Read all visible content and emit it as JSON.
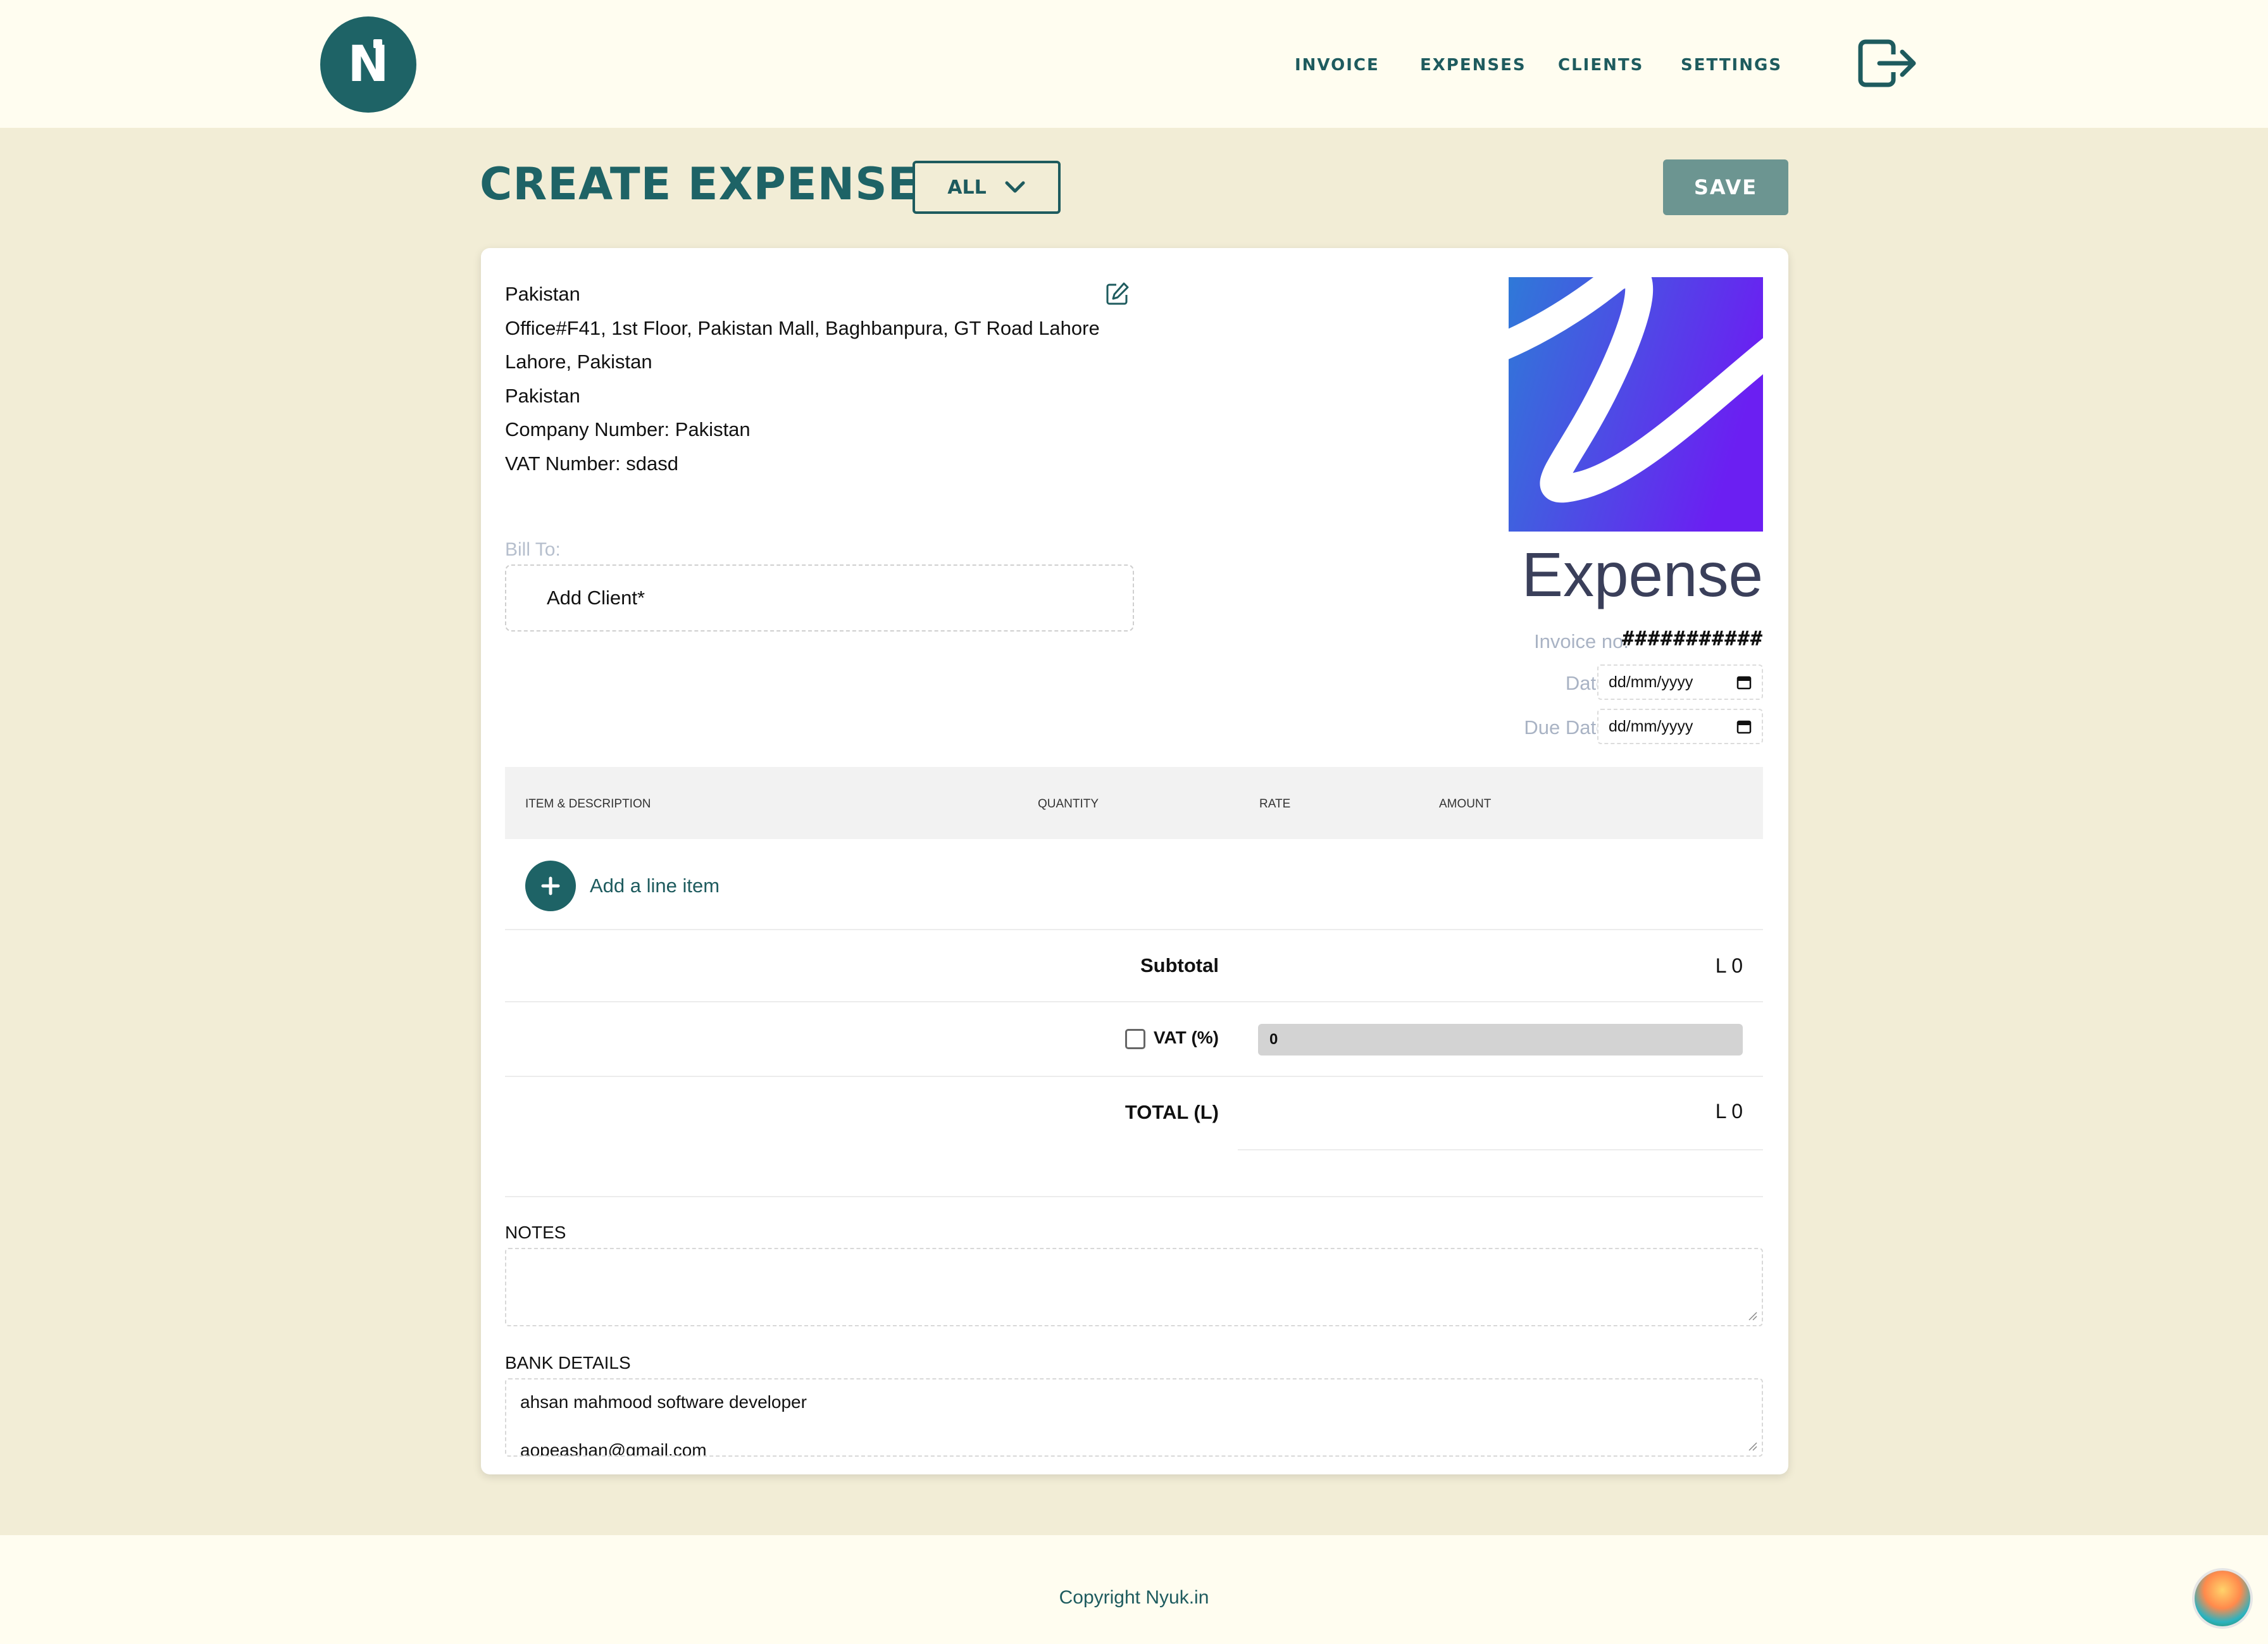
{
  "header": {
    "logo_text": "N",
    "nav": [
      "INVOICE",
      "EXPENSES",
      "CLIENTS",
      "SETTINGS"
    ]
  },
  "page": {
    "title": "CREATE EXPENSE",
    "filter_value": "ALL",
    "save_label": "SAVE"
  },
  "company": {
    "lines": [
      "Pakistan",
      "Office#F41, 1st Floor, Pakistan Mall, Baghbanpura, GT Road Lahore",
      "Lahore, Pakistan",
      "Pakistan",
      "Company Number: Pakistan",
      "VAT Number: sdasd"
    ]
  },
  "document": {
    "type": "Expense",
    "invoice_no_label": "Invoice no:",
    "invoice_no_value": "###########",
    "date_label": "Date:",
    "date_placeholder": "dd/mm/yyyy",
    "due_date_label": "Due Date:",
    "due_date_placeholder": "dd/mm/yyyy"
  },
  "bill_to": {
    "label": "Bill To:",
    "add_client": "Add Client*"
  },
  "items_table": {
    "columns": [
      "ITEM & DESCRIPTION",
      "QUANTITY",
      "RATE",
      "AMOUNT"
    ],
    "add_line_label": "Add a line item"
  },
  "totals": {
    "subtotal_label": "Subtotal",
    "subtotal_value": "L 0",
    "vat_label": "VAT (%)",
    "vat_value": "0",
    "total_label": "TOTAL (L)",
    "total_value": "L 0"
  },
  "notes": {
    "label": "NOTES",
    "value": ""
  },
  "bank_details": {
    "label": "BANK DETAILS",
    "value": "ahsan mahmood software developer\naopeashan@gmail.com"
  },
  "footer": {
    "copyright": "Copyright Nyuk.in"
  },
  "colors": {
    "brand": "#1e6366",
    "page_bg": "#f2edd6",
    "header_bg": "#fffdf0",
    "save_bg": "#6c9591"
  }
}
